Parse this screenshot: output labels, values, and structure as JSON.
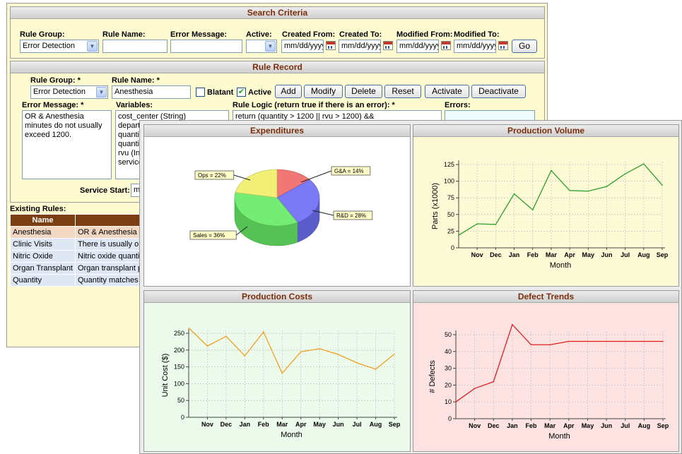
{
  "search": {
    "title": "Search Criteria",
    "rule_group_label": "Rule Group:",
    "rule_group_value": "Error Detection",
    "rule_name_label": "Rule Name:",
    "error_message_label": "Error Message:",
    "active_label": "Active:",
    "created_from_label": "Created From:",
    "created_to_label": "Created To:",
    "modified_from_label": "Modified From:",
    "modified_to_label": "Modified To:",
    "date_placeholder": "mm/dd/yyyy",
    "go_label": "Go"
  },
  "record": {
    "title": "Rule Record",
    "rule_group_label": "Rule Group: *",
    "rule_group_value": "Error Detection",
    "rule_name_label": "Rule Name: *",
    "rule_name_value": "Anesthesia",
    "blatant_label": "Blatant",
    "active_label": "Active",
    "buttons": [
      "Add",
      "Modify",
      "Delete",
      "Reset",
      "Activate",
      "Deactivate"
    ],
    "error_message_label": "Error Message: *",
    "error_message_value": "OR & Anesthesia minutes do not usually exceed 1200.",
    "variables_label": "Variables:",
    "variables": [
      "cost_center (String)",
      "depart",
      "quantit",
      "quantit",
      "rvu (Int",
      "service"
    ],
    "rule_logic_label": "Rule Logic (return true if there is an error): *",
    "rule_logic_value": "return (quantity > 1200 || rvu > 1200) &&",
    "errors_label": "Errors:",
    "service_start_label": "Service Start:",
    "service_start_value": "mm"
  },
  "existing": {
    "label": "Existing Rules:",
    "name_header": "Name",
    "rows": [
      {
        "name": "Anesthesia",
        "msg": "OR & Anesthesia min"
      },
      {
        "name": "Clinic Visits",
        "msg": "There is usually one"
      },
      {
        "name": "Nitric Oxide",
        "msg": "Nitric oxide quantity m"
      },
      {
        "name": "Organ Transplant",
        "msg": "Organ transplant proc"
      },
      {
        "name": "Quantity",
        "msg": "Quantity matches the"
      }
    ]
  },
  "colors": {
    "panel_title": "#7a2f0c",
    "search_bg": "#fefbd0",
    "table_header": "#7a3e12",
    "volume_line": "#2e9e2e",
    "costs_line": "#f0a020",
    "defect_line": "#e02020"
  },
  "chart_data": [
    {
      "type": "pie",
      "title": "Expenditures",
      "slices": [
        {
          "label": "G&A = 14%",
          "value": 14,
          "color": "#f06a6a"
        },
        {
          "label": "R&D = 28%",
          "value": 28,
          "color": "#6f6ff5"
        },
        {
          "label": "Sales = 36%",
          "value": 36,
          "color": "#69ec69"
        },
        {
          "label": "Ops = 22%",
          "value": 22,
          "color": "#f0ee6a"
        }
      ],
      "bg": "#ffffff"
    },
    {
      "type": "line",
      "title": "Production Volume",
      "xlabel": "Month",
      "ylabel": "Parts (x1000)",
      "categories": [
        "",
        "Nov",
        "Dec",
        "Jan",
        "Feb",
        "Mar",
        "Apr",
        "May",
        "Jun",
        "Jul",
        "Aug",
        "Sep"
      ],
      "values": [
        19,
        36,
        35,
        81,
        57,
        116,
        86,
        85,
        92,
        111,
        126,
        94
      ],
      "ylim": [
        0,
        125
      ],
      "yticks": [
        0,
        25,
        50,
        75,
        100,
        125
      ],
      "color": "#2e9e2e",
      "bg": "#fdfbd6"
    },
    {
      "type": "line",
      "title": "Production Costs",
      "xlabel": "Month",
      "ylabel": "Unit Cost ($)",
      "categories": [
        "",
        "Nov",
        "Dec",
        "Jan",
        "Feb",
        "Mar",
        "Apr",
        "May",
        "Jun",
        "Jul",
        "Aug",
        "Sep"
      ],
      "values": [
        266,
        212,
        241,
        183,
        254,
        131,
        195,
        204,
        187,
        162,
        143,
        188
      ],
      "ylim": [
        0,
        250
      ],
      "yticks": [
        0,
        50,
        100,
        150,
        200,
        250
      ],
      "color": "#f0a020",
      "bg": "#ecfaec"
    },
    {
      "type": "line",
      "title": "Defect Trends",
      "xlabel": "Month",
      "ylabel": "# Defects",
      "categories": [
        "",
        "Nov",
        "Dec",
        "Jan",
        "Feb",
        "Mar",
        "Apr",
        "May",
        "Jun",
        "Jul",
        "Aug",
        "Sep"
      ],
      "values": [
        10,
        18,
        22,
        56,
        44,
        44,
        46,
        46,
        46,
        46,
        46,
        46
      ],
      "ylim": [
        0,
        50
      ],
      "yticks": [
        0,
        10,
        20,
        30,
        40,
        50
      ],
      "color": "#e02020",
      "bg": "#fde2e2"
    }
  ]
}
